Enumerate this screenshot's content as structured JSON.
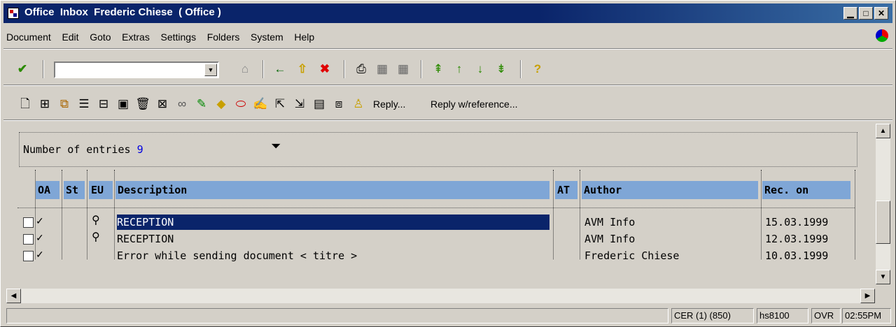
{
  "window": {
    "title": "Office  Inbox  Frederic Chiese  ( Office )",
    "controls": [
      "_",
      "□",
      "×"
    ]
  },
  "menu": [
    "Document",
    "Edit",
    "Goto",
    "Extras",
    "Settings",
    "Folders",
    "System",
    "Help"
  ],
  "toolbar1": {
    "command_value": "",
    "icons": [
      "enter-check-icon",
      "save-icon",
      "back-icon",
      "exit-icon",
      "cancel-icon",
      "print-icon",
      "find-icon",
      "find-next-icon",
      "first-page-icon",
      "previous-page-icon",
      "next-page-icon",
      "last-page-icon",
      "help-icon"
    ]
  },
  "toolbar2": {
    "reply_label": "Reply...",
    "reply_ref_label": "Reply w/reference..."
  },
  "list": {
    "entries_label": "Number of entries",
    "entries_count": "9",
    "columns": [
      "OA",
      "St",
      "EU",
      "Description",
      "AT",
      "Author",
      "Rec. on"
    ],
    "rows": [
      {
        "oa": "✓",
        "description": "RECEPTION",
        "author": "AVM Info",
        "rec_on": "15.03.1999",
        "selected": true
      },
      {
        "oa": "✓",
        "description": "RECEPTION",
        "author": "AVM Info",
        "rec_on": "12.03.1999",
        "selected": false
      },
      {
        "oa": "✓",
        "description": "Error while sending document < titre >",
        "author": "Frederic Chiese",
        "rec_on": "10.03.1999",
        "selected": false
      }
    ]
  },
  "status": {
    "system": "CER (1) (850)",
    "server": "hs8100",
    "mode": "OVR",
    "time": "02:55PM"
  }
}
